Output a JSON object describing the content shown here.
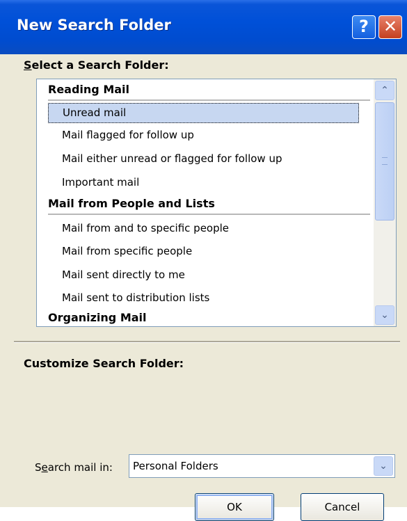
{
  "window": {
    "title": "New Search Folder"
  },
  "titlebar": {
    "help_glyph": "?",
    "close_glyph": "✕"
  },
  "section_select": {
    "label_prefix": "S",
    "label_rest": "elect a Search Folder:"
  },
  "list": {
    "groups": [
      {
        "heading": "Reading Mail",
        "items": [
          "Unread mail",
          "Mail flagged for follow up",
          "Mail either unread or flagged for follow up",
          "Important mail"
        ]
      },
      {
        "heading": "Mail from People and Lists",
        "items": [
          "Mail from and to specific people",
          "Mail from specific people",
          "Mail sent directly to me",
          "Mail sent to distribution lists"
        ]
      },
      {
        "heading": "Organizing Mail",
        "items": []
      }
    ],
    "selected_item": "Unread mail"
  },
  "scrollbar": {
    "up_glyph": "⌃",
    "down_glyph": "⌄"
  },
  "section_customize": {
    "label": "Customize Search Folder:"
  },
  "search_in": {
    "label_pre": "S",
    "label_u": "e",
    "label_post": "arch mail in:",
    "value": "Personal Folders",
    "arrow_glyph": "⌄"
  },
  "buttons": {
    "ok": "OK",
    "cancel": "Cancel"
  }
}
